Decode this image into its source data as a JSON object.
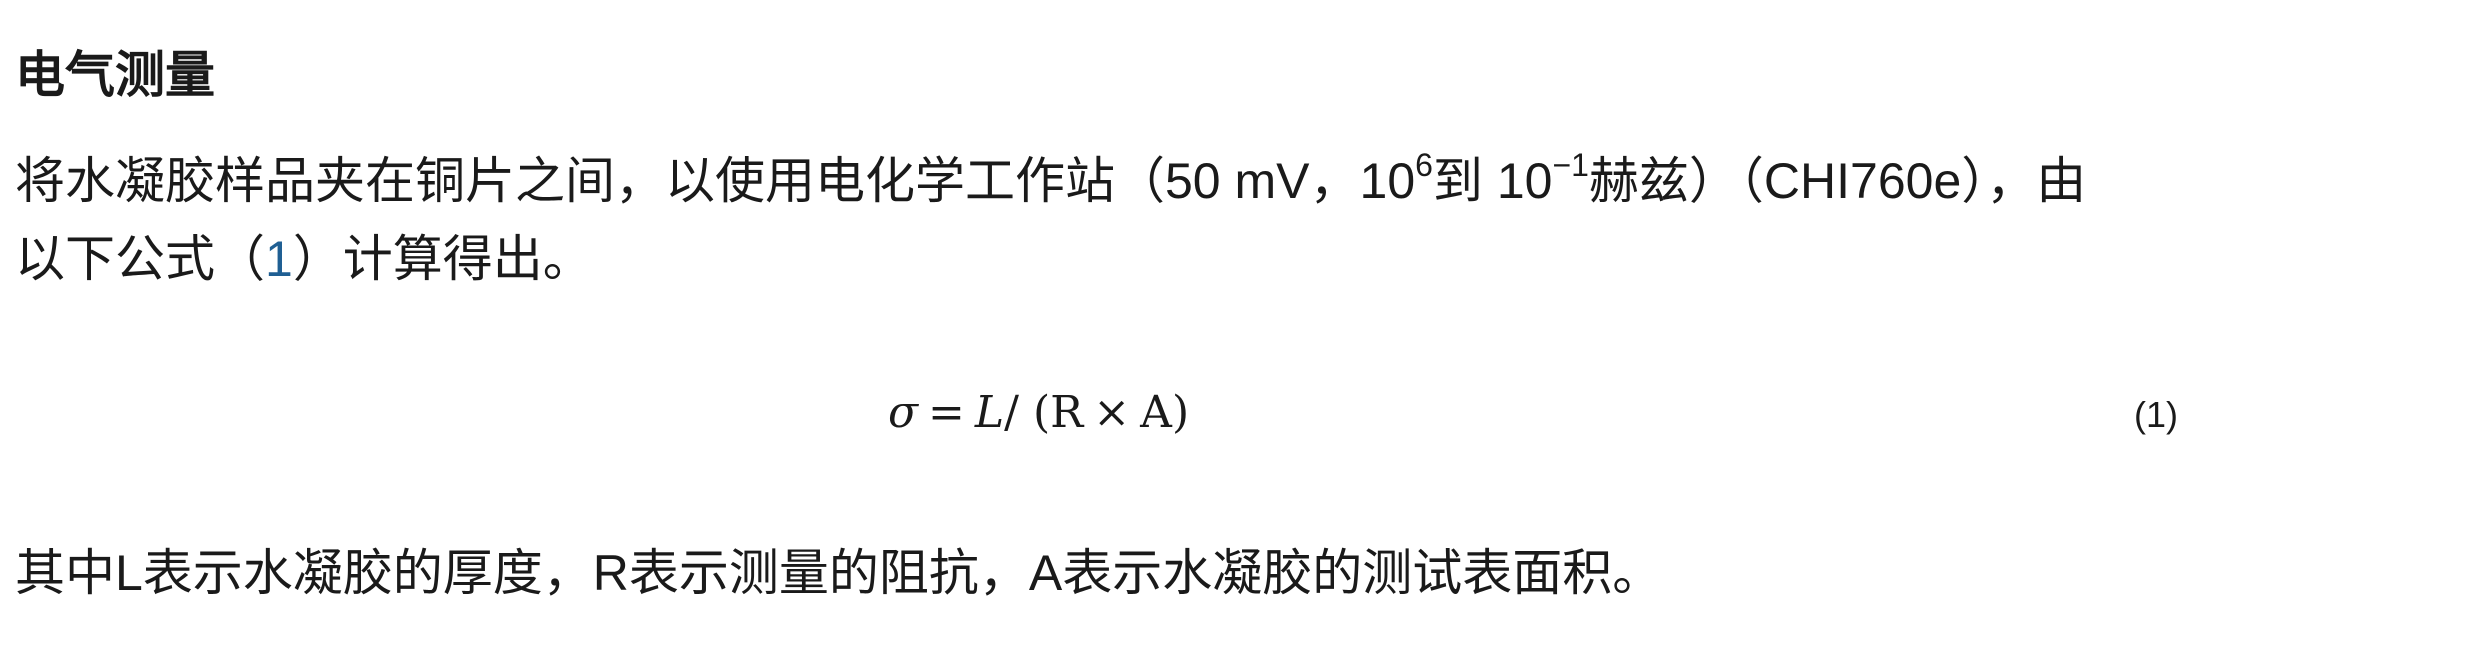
{
  "section": {
    "heading": "电气测量",
    "para1": {
      "line1_a": "将水凝胶样品夹在铜片之间，以使用电化学工作站（50 mV，10",
      "sup1": "6",
      "line1_b": "到 10",
      "sup2": "−1",
      "line1_c": "赫兹）（CHI760e），由",
      "line2_a": "以下公式（",
      "eq_ref": "1",
      "line2_b": "）计算得出。"
    },
    "equation": {
      "sigma": "σ",
      "equals": "=",
      "L": "L",
      "slash": "/",
      "open": "(",
      "R": "R",
      "times": "×",
      "A": "A",
      "close": ")",
      "number": "(1)"
    },
    "para2": "其中L表示水凝胶的厚度，R表示测量的阻抗，A表示水凝胶的测试表面积。"
  }
}
